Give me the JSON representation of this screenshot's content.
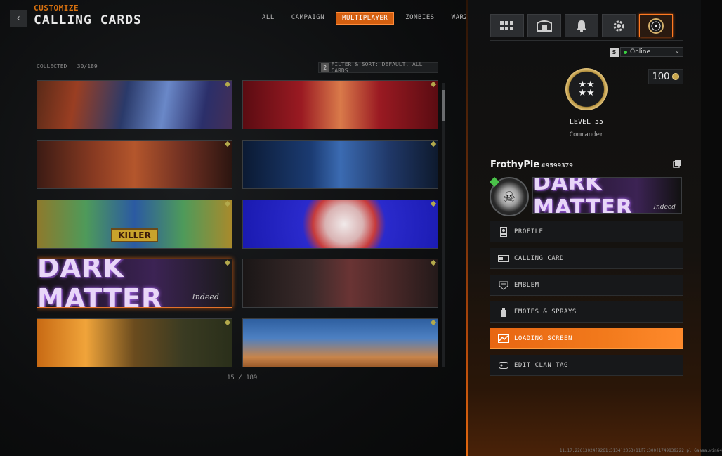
{
  "header": {
    "breadcrumb": "CUSTOMIZE",
    "title": "CALLING CARDS",
    "back_icon": "chevron-left-icon"
  },
  "tabs": [
    {
      "label": "ALL",
      "active": false
    },
    {
      "label": "CAMPAIGN",
      "active": false
    },
    {
      "label": "MULTIPLAYER",
      "active": true
    },
    {
      "label": "ZOMBIES",
      "active": false
    },
    {
      "label": "WARZONE",
      "active": false
    }
  ],
  "collection": {
    "collected_label": "COLLECTED | 30/189",
    "filter_key": "2",
    "filter_label": "FILTER & SORT: DEFAULT, ALL CARDS"
  },
  "cards": [
    {
      "id": "c1",
      "selected": false
    },
    {
      "id": "c2",
      "selected": false
    },
    {
      "id": "c3",
      "selected": false
    },
    {
      "id": "c4",
      "selected": false
    },
    {
      "id": "c5",
      "selected": false,
      "text": "KILLER"
    },
    {
      "id": "c6",
      "selected": false
    },
    {
      "id": "c7",
      "selected": true,
      "text": "DARK MATTER",
      "subtext": "Indeed"
    },
    {
      "id": "c8",
      "selected": false
    },
    {
      "id": "c9",
      "selected": false
    },
    {
      "id": "c10",
      "selected": false
    }
  ],
  "pager": "15 / 189",
  "right_panel": {
    "icon_buttons": [
      "grid-icon",
      "barracks-icon",
      "bell-icon",
      "gear-icon",
      "profile-rank-icon"
    ],
    "status_badge": "S",
    "status": "Online",
    "currency_amount": "100",
    "level": "LEVEL 55",
    "rank_title": "Commander",
    "gamertag": "FrothyPie",
    "gamertag_id": "#9599379",
    "banner_text": "DARK MATTER",
    "banner_subtext": "Indeed",
    "menu": [
      {
        "label": "PROFILE",
        "icon": "profile-icon",
        "active": false
      },
      {
        "label": "CALLING CARD",
        "icon": "calling-card-icon",
        "active": false
      },
      {
        "label": "EMBLEM",
        "icon": "emblem-icon",
        "active": false
      },
      {
        "label": "EMOTES & SPRAYS",
        "icon": "spray-icon",
        "active": false
      },
      {
        "label": "LOADING SCREEN",
        "icon": "loading-screen-icon",
        "active": true
      },
      {
        "label": "EDIT CLAN TAG",
        "icon": "clan-tag-icon",
        "active": false
      }
    ]
  },
  "colors": {
    "accent": "#e86612",
    "online": "#3bd142"
  },
  "build_info": "11.17.22613024[9261:3134]2053+11[7:300]1749839222.pl.Gaaaa.win64"
}
